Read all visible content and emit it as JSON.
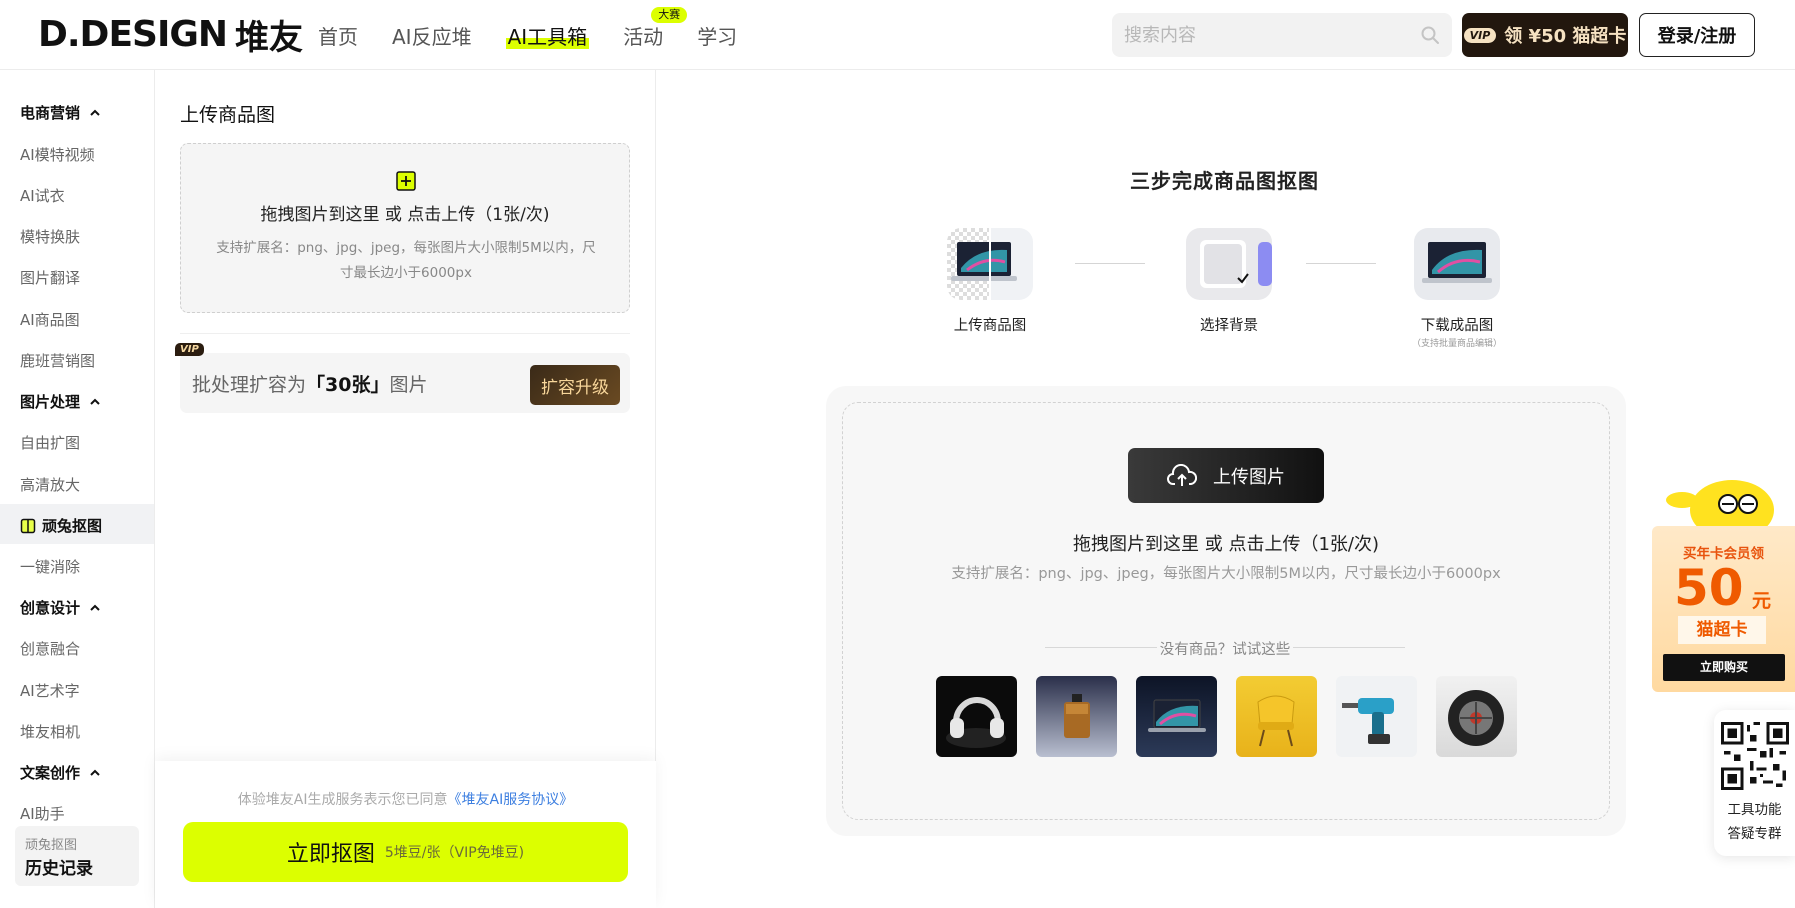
{
  "header": {
    "logo_text": "D.DESIGN",
    "logo_cn": "堆友",
    "nav": [
      {
        "label": "首页"
      },
      {
        "label": "AI反应堆"
      },
      {
        "label": "AI工具箱"
      },
      {
        "label": "活动",
        "badge": "大赛"
      },
      {
        "label": "学习"
      }
    ],
    "search_placeholder": "搜索内容",
    "vip_chip": "VIP",
    "vip_label": "领 ¥50 猫超卡",
    "login_label": "登录/注册"
  },
  "sidebar": {
    "groups": [
      {
        "label": "电商营销",
        "items": [
          "AI模特视频",
          "AI试衣",
          "模特换肤",
          "图片翻译",
          "AI商品图",
          "鹿班营销图"
        ]
      },
      {
        "label": "图片处理",
        "items": [
          "自由扩图",
          "高清放大",
          "顽兔抠图",
          "一键消除"
        ]
      },
      {
        "label": "创意设计",
        "items": [
          "创意融合",
          "AI艺术字",
          "堆友相机"
        ]
      },
      {
        "label": "文案创作",
        "items": [
          "AI助手"
        ]
      }
    ],
    "active_item": "顽兔抠图",
    "history_sub": "顽兔抠图",
    "history_main": "历史记录"
  },
  "left_panel": {
    "title": "上传商品图",
    "drop_main": "拖拽图片到这里 或 点击上传（1张/次)",
    "drop_sub": "支持扩展名：png、jpg、jpeg，每张图片大小限制5M以内，尺寸最长边小于6000px",
    "vip_tag": "VIP",
    "batch_prefix": "批处理扩容为",
    "batch_bold": "「30张」",
    "batch_suffix": "图片",
    "upgrade_label": "扩容升级",
    "agree_text": "体验堆友AI生成服务表示您已同意",
    "agree_link": "《堆友AI服务协议》",
    "go_label": "立即抠图",
    "go_cost": "5堆豆/张（VIP免堆豆)"
  },
  "main": {
    "steps_title": "三步完成商品图抠图",
    "steps": [
      {
        "label": "上传商品图",
        "sub": ""
      },
      {
        "label": "选择背景",
        "sub": ""
      },
      {
        "label": "下载成品图",
        "sub": "（支持批量商品编辑）"
      }
    ],
    "upload_btn": "上传图片",
    "upload_main": "拖拽图片到这里 或 点击上传（1张/次)",
    "upload_sub": "支持扩展名：png、jpg、jpeg，每张图片大小限制5M以内，尺寸最长边小于6000px",
    "try_text": "没有商品？试试这些",
    "samples": [
      "headphones",
      "perfume",
      "laptop",
      "chair",
      "drill",
      "tire"
    ]
  },
  "promo": {
    "t1": "买年卡会员领",
    "num": "50",
    "unit": "元",
    "t2": "猫超卡",
    "buy": "立即购买"
  },
  "qr": {
    "t1": "工具功能",
    "t2": "答疑专群"
  },
  "colors": {
    "accent": "#dcff00",
    "dark": "#22170e",
    "promo_orange": "#ef5a00"
  }
}
